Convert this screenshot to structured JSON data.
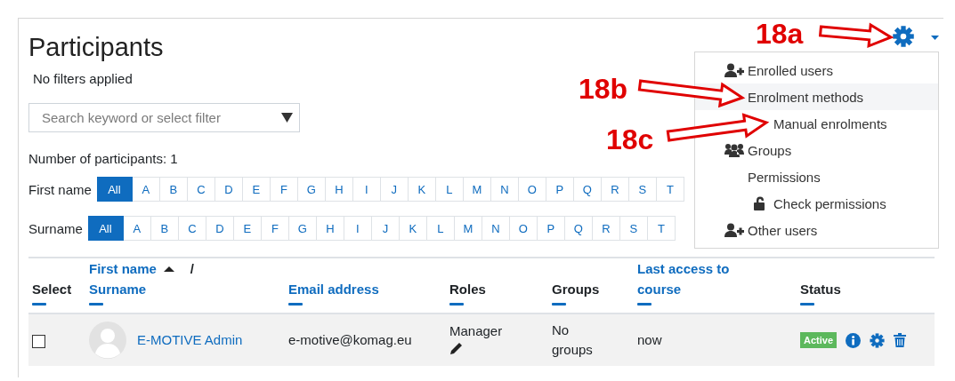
{
  "page": {
    "title": "Participants",
    "filter_status": "No filters applied",
    "search": {
      "placeholder": "Search keyword or select filter"
    },
    "participant_count": "Number of participants: 1"
  },
  "initials_bars": [
    {
      "label": "First name",
      "letters": [
        {
          "text": "All",
          "selected": true
        },
        {
          "text": "A",
          "selected": false
        },
        {
          "text": "B",
          "selected": false
        },
        {
          "text": "C",
          "selected": false
        },
        {
          "text": "D",
          "selected": false
        },
        {
          "text": "E",
          "selected": false
        },
        {
          "text": "F",
          "selected": false
        },
        {
          "text": "G",
          "selected": false
        },
        {
          "text": "H",
          "selected": false
        },
        {
          "text": "I",
          "selected": false
        },
        {
          "text": "J",
          "selected": false
        },
        {
          "text": "K",
          "selected": false
        },
        {
          "text": "L",
          "selected": false
        },
        {
          "text": "M",
          "selected": false
        },
        {
          "text": "N",
          "selected": false
        },
        {
          "text": "O",
          "selected": false
        },
        {
          "text": "P",
          "selected": false
        },
        {
          "text": "Q",
          "selected": false
        },
        {
          "text": "R",
          "selected": false
        },
        {
          "text": "S",
          "selected": false
        },
        {
          "text": "T",
          "selected": false
        }
      ]
    },
    {
      "label": "Surname",
      "letters": [
        {
          "text": "All",
          "selected": true
        },
        {
          "text": "A",
          "selected": false
        },
        {
          "text": "B",
          "selected": false
        },
        {
          "text": "C",
          "selected": false
        },
        {
          "text": "D",
          "selected": false
        },
        {
          "text": "E",
          "selected": false
        },
        {
          "text": "F",
          "selected": false
        },
        {
          "text": "G",
          "selected": false
        },
        {
          "text": "H",
          "selected": false
        },
        {
          "text": "I",
          "selected": false
        },
        {
          "text": "J",
          "selected": false
        },
        {
          "text": "K",
          "selected": false
        },
        {
          "text": "L",
          "selected": false
        },
        {
          "text": "M",
          "selected": false
        },
        {
          "text": "N",
          "selected": false
        },
        {
          "text": "O",
          "selected": false
        },
        {
          "text": "P",
          "selected": false
        },
        {
          "text": "Q",
          "selected": false
        },
        {
          "text": "R",
          "selected": false
        },
        {
          "text": "S",
          "selected": false
        },
        {
          "text": "T",
          "selected": false
        }
      ]
    }
  ],
  "table": {
    "columns": [
      {
        "kind": "plain",
        "label": "Select"
      },
      {
        "kind": "dual",
        "labels": [
          "First name",
          "Surname"
        ],
        "separator": "/",
        "sorted": true
      },
      {
        "kind": "link",
        "label": "Email address"
      },
      {
        "kind": "plain",
        "label": "Roles"
      },
      {
        "kind": "plain",
        "label": "Groups"
      },
      {
        "kind": "link",
        "label": "Last access to course"
      },
      {
        "kind": "plain",
        "label": "Status"
      }
    ],
    "rows": [
      {
        "checked": false,
        "name": "E-MOTIVE Admin",
        "email": "e-motive@komag.eu",
        "roles": "Manager",
        "groups": "No groups",
        "last_access": "now",
        "status": "Active"
      }
    ]
  },
  "settings_menu": {
    "expanded": true,
    "items": [
      {
        "kind": "adduser",
        "label": "Enrolled users",
        "selected": false
      },
      {
        "kind": "text",
        "label": "Enrolment methods",
        "selected": true,
        "children": [
          {
            "kind": "text",
            "label": "Manual enrolments",
            "selected": false
          }
        ]
      },
      {
        "kind": "group",
        "label": "Groups",
        "selected": false
      },
      {
        "kind": "text",
        "label": "Permissions",
        "selected": false,
        "children": [
          {
            "kind": "unlock",
            "label": "Check permissions",
            "selected": false
          }
        ]
      },
      {
        "kind": "adduser",
        "label": "Other users",
        "selected": false
      }
    ]
  },
  "annotations": [
    {
      "label": "18a"
    },
    {
      "label": "18b"
    },
    {
      "label": "18c"
    }
  ]
}
